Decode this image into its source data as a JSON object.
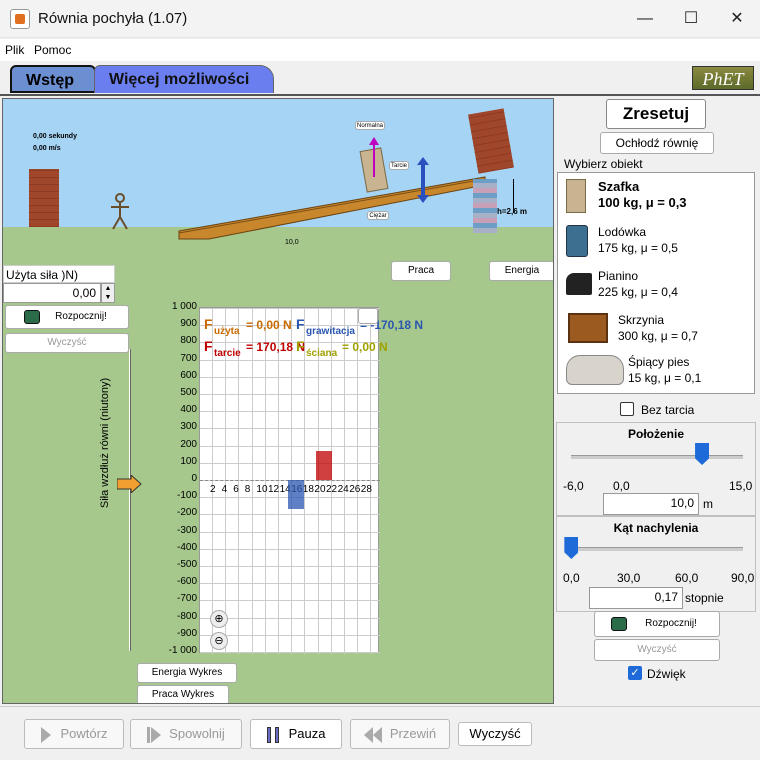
{
  "window": {
    "title": "Równia pochyła (1.07)",
    "minimize": "—",
    "maximize": "☐",
    "close": "✕"
  },
  "menu": {
    "items": [
      "Plik",
      "Pomoc"
    ]
  },
  "tabs": [
    {
      "label": "Wstęp"
    },
    {
      "label": "Więcej możliwości"
    }
  ],
  "phet_logo": "PhET",
  "scene": {
    "time": "0,00 sekundy",
    "velocity": "0,00 m/s",
    "normal_label": "Normalna",
    "friction_label": "Tarcie",
    "weight_label": "Ciężar",
    "height_label": "h=2,6 m",
    "position_marker": "10,0",
    "work_button": "Praca",
    "energy_button": "Energia"
  },
  "applied_force": {
    "label": "Użyta siła )N)",
    "value": "0,00",
    "start_button": "Rozpocznij!",
    "clear_button": "Wyczyść"
  },
  "chart_data": {
    "type": "bar",
    "ylabel": "Siła wzdłuż równi (niutony)",
    "ylim": [
      -1000,
      1000
    ],
    "y_ticks": [
      "1 000",
      "900",
      "800",
      "700",
      "600",
      "500",
      "400",
      "300",
      "200",
      "100",
      "0",
      "-100",
      "-200",
      "-300",
      "-400",
      "-500",
      "-600",
      "-700",
      "-800",
      "-900",
      "-1 000"
    ],
    "x_ticks": [
      "2",
      "4",
      "6",
      "8",
      "10",
      "12",
      "14",
      "16",
      "18",
      "20",
      "22",
      "24",
      "26",
      "28"
    ],
    "series": [
      {
        "name": "F użyta",
        "value": 0.0,
        "label": "= 0,00 N",
        "color": "#c86a00"
      },
      {
        "name": "F grawitacja",
        "value": -170.18,
        "label": "= -170,18 N",
        "color": "#2a56b0"
      },
      {
        "name": "F tarcie",
        "value": 170.18,
        "label": "= 170,18 N",
        "color": "#c00000"
      },
      {
        "name": "F ściana",
        "value": 0.0,
        "label": "= 0,00 N",
        "color": "#a0a000"
      }
    ],
    "legend": {
      "F_main": "F",
      "uzyta_sub": "użyta",
      "uzyta_val": "= 0,00 N",
      "grav_sub": "grawitacja",
      "grav_val": "= -170,18 N",
      "tarcie_sub": "tarcie",
      "tarcie_val": "= 170,18 N",
      "sciana_sub": "ściana",
      "sciana_val": "= 0,00 N"
    }
  },
  "chart_buttons": {
    "energy_graph": "Energia Wykres",
    "work_graph": "Praca Wykres"
  },
  "panel": {
    "reset": "Zresetuj",
    "cool_ramp": "Ochłodź równię",
    "choose_object": "Wybierz obiekt",
    "objects": [
      {
        "name": "Szafka",
        "desc": "100 kg, μ = 0,3",
        "icon": "cabinet-icon",
        "selected": true
      },
      {
        "name": "Lodówka",
        "desc": "175 kg, μ = 0,5",
        "icon": "fridge-icon"
      },
      {
        "name": "Pianino",
        "desc": "225 kg, μ = 0,4",
        "icon": "piano-icon"
      },
      {
        "name": "Skrzynia",
        "desc": "300 kg, μ = 0,7",
        "icon": "crate-icon"
      },
      {
        "name": "Śpiący pies",
        "desc": "15 kg, μ = 0,1",
        "icon": "dog-icon"
      }
    ],
    "frictionless": "Bez tarcia",
    "position": {
      "title": "Położenie",
      "min": "-6,0",
      "mid": "0,0",
      "max": "15,0",
      "value": "10,0",
      "unit": "m",
      "slider_fraction": 0.762
    },
    "angle": {
      "title": "Kąt nachylenia",
      "ticks": [
        "0,0",
        "30,0",
        "60,0",
        "90,0"
      ],
      "value": "0,17",
      "unit": "stopnie",
      "slider_fraction": 0.002
    },
    "start_button": "Rozpocznij!",
    "clear_button": "Wyczyść",
    "sound": "Dźwięk"
  },
  "controls": {
    "replay": "Powtórz",
    "slow": "Spowolnij",
    "pause": "Pauza",
    "rewind": "Przewiń",
    "clear": "Wyczyść"
  }
}
